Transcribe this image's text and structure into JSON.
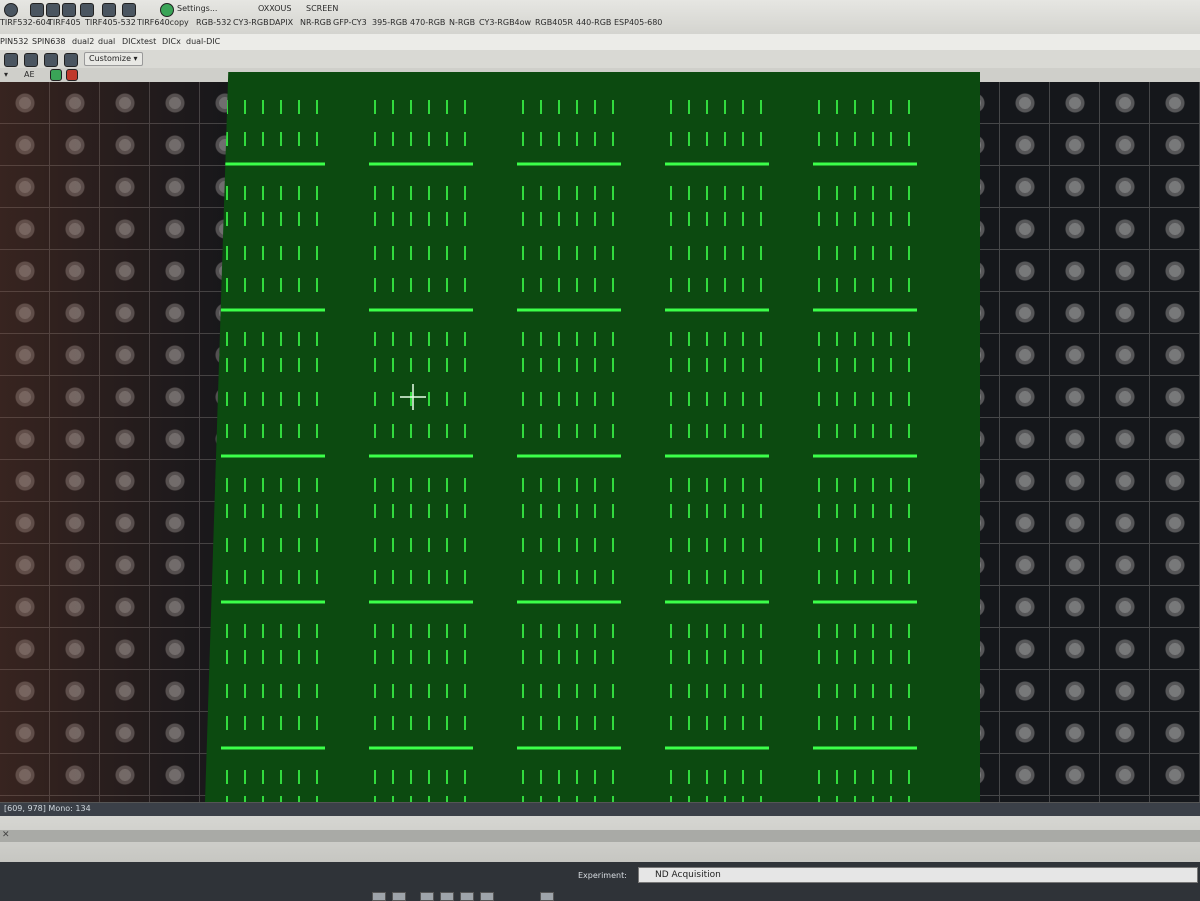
{
  "toolbar": {
    "preset_buttons": [
      "Settings...",
      "OXXOUS",
      "SCREEN",
      "Customize"
    ],
    "preset_row": [
      "TIRF532-604",
      "TIRF405",
      "TIRF405-532",
      "TIRF640copy",
      "RGB-532",
      "CY3-RGB",
      "DAPIX",
      "NR-RGB",
      "GFP-CY3",
      "395-RGB",
      "470-RGB",
      "N-RGB",
      "CY3-RGB4ow",
      "RGB405R",
      "440-RGB",
      "ESP405-680"
    ],
    "channel_row": [
      "PIN532",
      "SPIN638",
      "dual2",
      "dual",
      "DICxtest",
      "DICx",
      "dual-DIC"
    ],
    "customize_label": "Customize",
    "view_label": "AE"
  },
  "image": {
    "crosshair": "crosshair-cursor",
    "grid_cols": 5,
    "grid_rows": 5,
    "colors": {
      "background": "#0c4a10",
      "marker": "#3cff4a"
    }
  },
  "status": {
    "text": "[609, 978] Mono: 134"
  },
  "experiment": {
    "label": "Experiment:",
    "value": "ND Acquisition"
  }
}
